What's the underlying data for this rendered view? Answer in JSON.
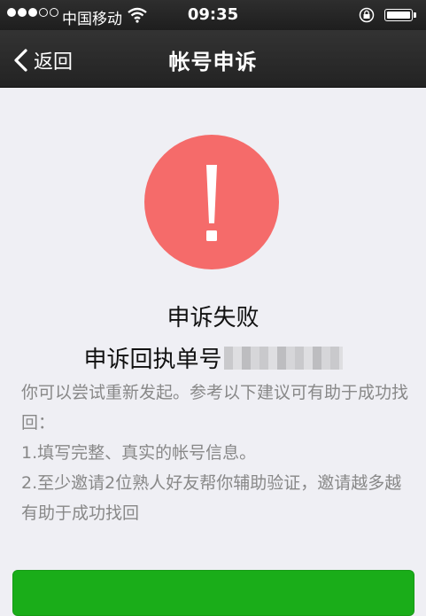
{
  "status_bar": {
    "carrier": "中国移动",
    "time": "09:35",
    "signal_strength": "3 of 5"
  },
  "nav": {
    "back_label": "返回",
    "title": "帐号申诉"
  },
  "result": {
    "icon": "exclamation-icon",
    "title": "申诉失败",
    "receipt_label": "申诉回执单号"
  },
  "tips": {
    "intro": "你可以尝试重新发起。参考以下建议可有助于成功找回：",
    "item1": "1.填写完整、真实的帐号信息。",
    "item2": "2.至少邀请2位熟人好友帮你辅助验证，邀请越多越有助于成功找回"
  },
  "colors": {
    "alert_red": "#f56b6a",
    "button_green": "#1aad19",
    "nav_background": "#2a2a2a",
    "tip_text": "#888888"
  }
}
